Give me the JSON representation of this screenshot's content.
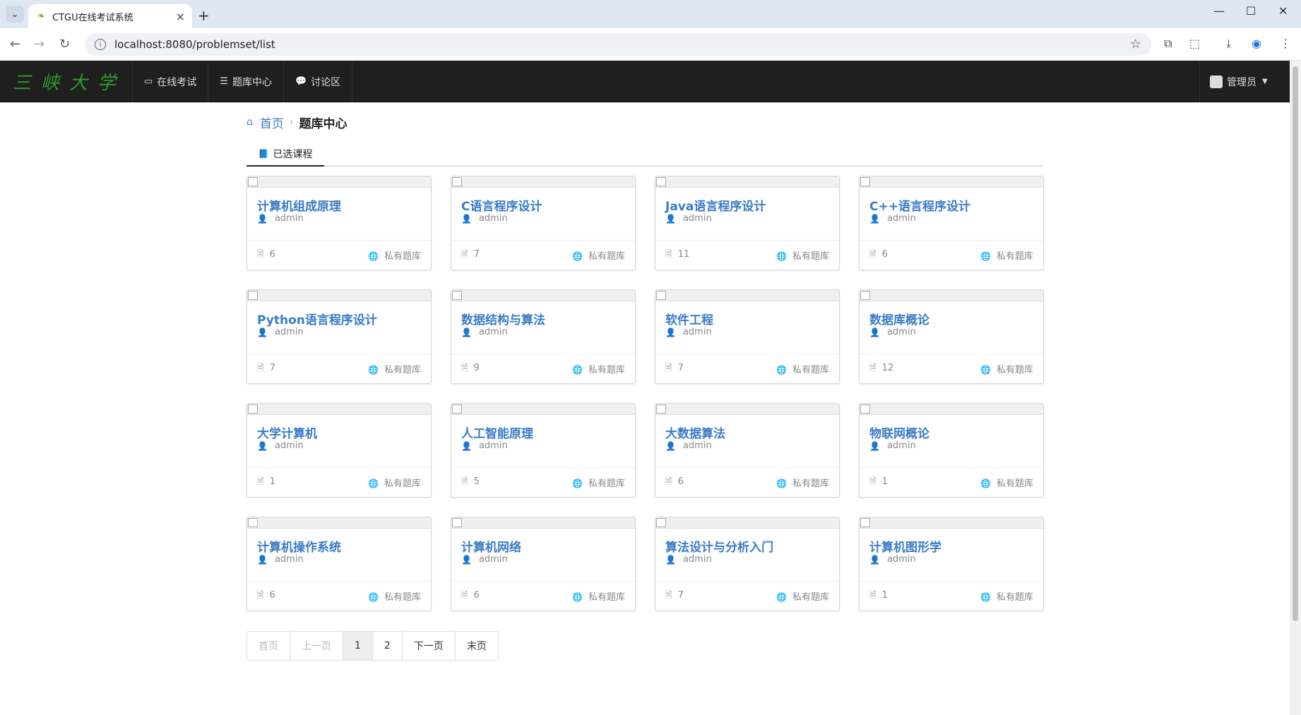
{
  "browser": {
    "tab_title": "CTGU在线考试系统",
    "tab_close": "×",
    "new_tab": "+",
    "url": "localhost:8080/problemset/list"
  },
  "navbar": {
    "brand": "三峡大学",
    "items": [
      {
        "label": "在线考试",
        "icon": "desktop-icon"
      },
      {
        "label": "题库中心",
        "icon": "list-icon"
      },
      {
        "label": "讨论区",
        "icon": "comment-icon"
      }
    ],
    "user": "管理员"
  },
  "breadcrumb": {
    "home": "首页",
    "current": "题库中心"
  },
  "tabs": {
    "active": "已选课程"
  },
  "courses": [
    {
      "title": "计算机组成原理",
      "author": "admin",
      "count": "6",
      "type": "私有题库"
    },
    {
      "title": "C语言程序设计",
      "author": "admin",
      "count": "7",
      "type": "私有题库"
    },
    {
      "title": "Java语言程序设计",
      "author": "admin",
      "count": "11",
      "type": "私有题库"
    },
    {
      "title": "C++语言程序设计",
      "author": "admin",
      "count": "6",
      "type": "私有题库"
    },
    {
      "title": "Python语言程序设计",
      "author": "admin",
      "count": "7",
      "type": "私有题库"
    },
    {
      "title": "数据结构与算法",
      "author": "admin",
      "count": "9",
      "type": "私有题库"
    },
    {
      "title": "软件工程",
      "author": "admin",
      "count": "7",
      "type": "私有题库"
    },
    {
      "title": "数据库概论",
      "author": "admin",
      "count": "12",
      "type": "私有题库"
    },
    {
      "title": "大学计算机",
      "author": "admin",
      "count": "1",
      "type": "私有题库"
    },
    {
      "title": "人工智能原理",
      "author": "admin",
      "count": "5",
      "type": "私有题库"
    },
    {
      "title": "大数据算法",
      "author": "admin",
      "count": "6",
      "type": "私有题库"
    },
    {
      "title": "物联网概论",
      "author": "admin",
      "count": "1",
      "type": "私有题库"
    },
    {
      "title": "计算机操作系统",
      "author": "admin",
      "count": "6",
      "type": "私有题库"
    },
    {
      "title": "计算机网络",
      "author": "admin",
      "count": "6",
      "type": "私有题库"
    },
    {
      "title": "算法设计与分析入门",
      "author": "admin",
      "count": "7",
      "type": "私有题库"
    },
    {
      "title": "计算机图形学",
      "author": "admin",
      "count": "1",
      "type": "私有题库"
    }
  ],
  "pagination": {
    "first": "首页",
    "prev": "上一页",
    "pages": [
      "1",
      "2"
    ],
    "next": "下一页",
    "last": "末页"
  }
}
